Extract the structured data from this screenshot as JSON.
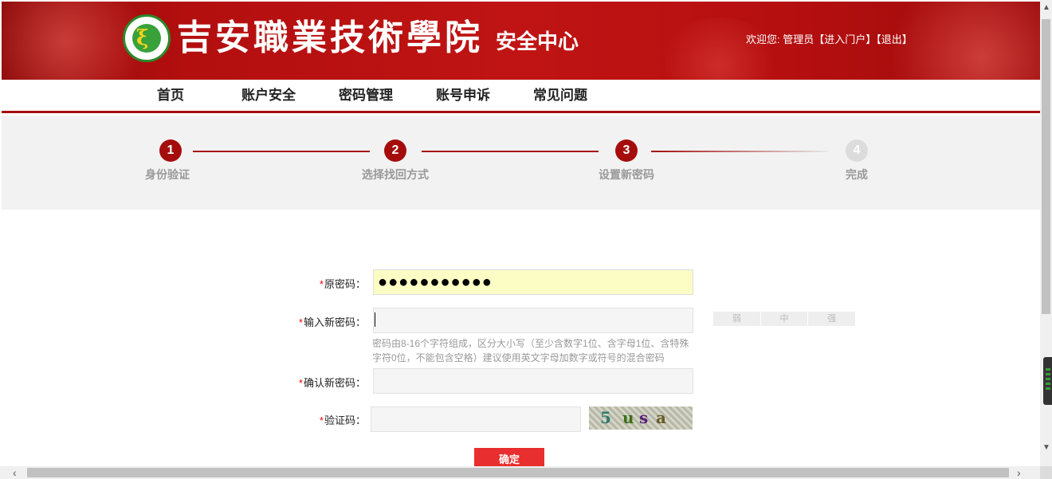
{
  "header": {
    "school_name": "吉安職業技術學院",
    "center_name": "安全中心",
    "welcome_prefix": "欢迎您: ",
    "user": "管理员",
    "portal_link": "【进入门户】",
    "logout_link": "【退出】",
    "logo_icon": "jian-college-emblem"
  },
  "nav": {
    "items": [
      {
        "label": "首页"
      },
      {
        "label": "账户安全"
      },
      {
        "label": "密码管理"
      },
      {
        "label": "账号申诉"
      },
      {
        "label": "常见问题"
      }
    ]
  },
  "steps": {
    "items": [
      {
        "number": "1",
        "label": "身份验证",
        "state": "done"
      },
      {
        "number": "2",
        "label": "选择找回方式",
        "state": "done"
      },
      {
        "number": "3",
        "label": "设置新密码",
        "state": "current"
      },
      {
        "number": "4",
        "label": "完成",
        "state": "pending"
      }
    ],
    "accent_color": "#a50d0d"
  },
  "form": {
    "old_password": {
      "star": "*",
      "label": "原密码：",
      "value": "●●●●●●●●●●●"
    },
    "new_password": {
      "star": "*",
      "label": "输入新密码：",
      "value": ""
    },
    "strength": {
      "weak": "弱",
      "medium": "中",
      "strong": "强"
    },
    "hint": "密码由8-16个字符组成，区分大小写（至少含数字1位、含字母1位、含特殊字符0位，不能包含空格）建议使用英文字母加数字或符号的混合密码",
    "confirm_password": {
      "star": "*",
      "label": "确认新密码：",
      "value": ""
    },
    "captcha": {
      "star": "*",
      "label": "验证码：",
      "value": "",
      "image_text": [
        "5",
        "u",
        "s",
        "a"
      ]
    },
    "submit_label": "确定"
  },
  "colors": {
    "brand_red": "#a50d0d",
    "submit_red": "#e82e2e",
    "filled_field": "#fbfdc4"
  }
}
